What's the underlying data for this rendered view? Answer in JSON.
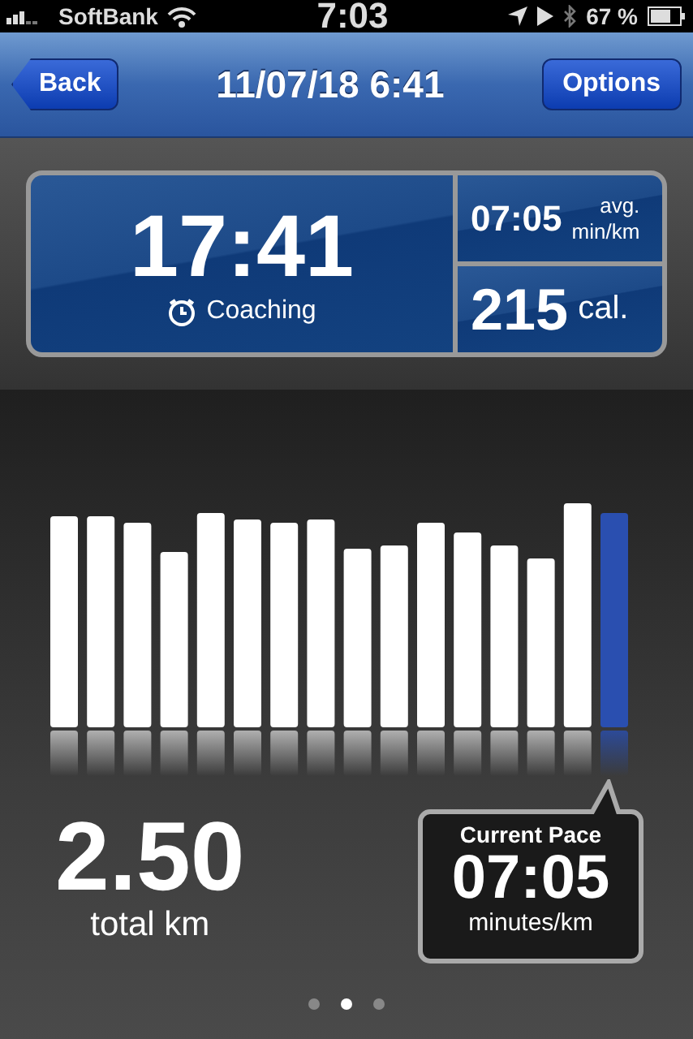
{
  "status_bar": {
    "carrier": "SoftBank",
    "time": "7:03",
    "battery": "67 %"
  },
  "nav_bar": {
    "back": "Back",
    "title": "11/07/18 6:41",
    "options": "Options"
  },
  "summary": {
    "duration": "17:41",
    "coaching": "Coaching",
    "avg_pace": "07:05",
    "avg_unit_top": "avg.",
    "avg_unit_bottom": "min/km",
    "calories": "215",
    "calories_unit": "cal."
  },
  "distance": {
    "value": "2.50",
    "label": "total km"
  },
  "current_pace": {
    "title": "Current Pace",
    "value": "07:05",
    "unit": "minutes/km"
  },
  "page_dots": [
    {
      "selected": false
    },
    {
      "selected": true
    },
    {
      "selected": false
    }
  ]
}
